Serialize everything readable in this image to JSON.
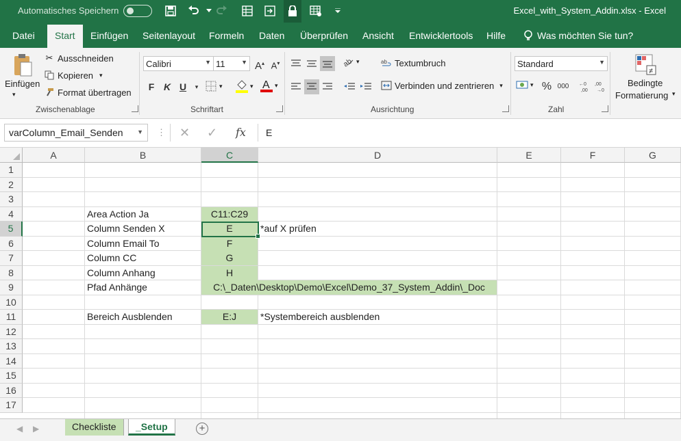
{
  "titlebar": {
    "autosave_label": "Automatisches Speichern",
    "doc_title": "Excel_with_System_Addin.xlsx  -  Excel"
  },
  "tabs": {
    "file": "Datei",
    "home": "Start",
    "insert": "Einfügen",
    "pagelayout": "Seitenlayout",
    "formulas": "Formeln",
    "data": "Daten",
    "review": "Überprüfen",
    "view": "Ansicht",
    "developer": "Entwicklertools",
    "help": "Hilfe",
    "tellme": "Was möchten Sie tun?"
  },
  "ribbon": {
    "clipboard": {
      "paste": "Einfügen",
      "cut": "Ausschneiden",
      "copy": "Kopieren",
      "format_painter": "Format übertragen",
      "label": "Zwischenablage"
    },
    "font": {
      "font_name": "Calibri",
      "font_size": "11",
      "bold": "F",
      "italic": "K",
      "underline": "U",
      "label": "Schriftart"
    },
    "alignment": {
      "wrap_text": "Textumbruch",
      "merge_center": "Verbinden und zentrieren",
      "label": "Ausrichtung"
    },
    "number": {
      "format": "Standard",
      "percent": "%",
      "thousands": "000",
      "label": "Zahl"
    },
    "styles": {
      "conditional_line1": "Bedingte",
      "conditional_line2": "Formatierung"
    }
  },
  "formula_bar": {
    "name_box": "varColumn_Email_Senden",
    "fx": "fx",
    "content": "E"
  },
  "grid": {
    "columns": [
      "A",
      "B",
      "C",
      "D",
      "E",
      "F",
      "G"
    ],
    "rows": [
      "1",
      "2",
      "3",
      "4",
      "5",
      "6",
      "7",
      "8",
      "9",
      "10",
      "11",
      "12",
      "13",
      "14",
      "15",
      "16",
      "17"
    ],
    "cells": {
      "B4": "Area Action Ja",
      "C4": "C11:C29",
      "B5": "Column Senden X",
      "C5": "E",
      "D5": "*auf X prüfen",
      "B6": "Column Email To",
      "C6": "F",
      "B7": "Column CC",
      "C7": "G",
      "B8": "Column Anhang",
      "C8": "H",
      "B9": "Pfad Anhänge",
      "C9": "C:\\_Daten\\Desktop\\Demo\\Excel\\Demo_37_System_Addin\\_Doc",
      "B11": "Bereich Ausblenden",
      "C11": "E:J",
      "D11": "*Systembereich ausblenden"
    },
    "selected_cell": "C5"
  },
  "sheets": {
    "tabs": [
      "Checkliste",
      "_Setup"
    ],
    "active": "_Setup"
  },
  "colors": {
    "accent": "#217346",
    "cell_fill": "#c6e0b4"
  }
}
